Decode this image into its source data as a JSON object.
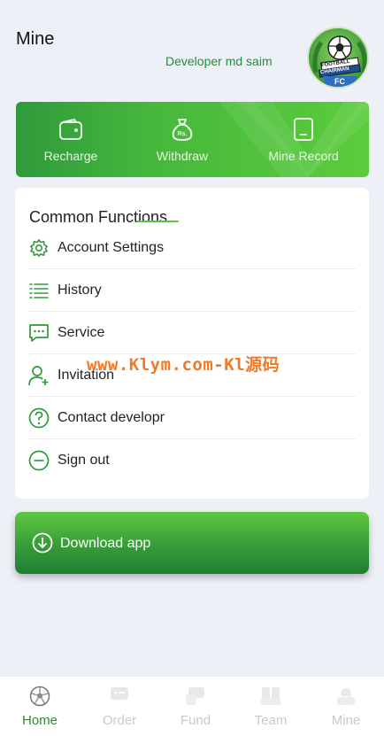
{
  "header": {
    "title": "Mine",
    "developer": "Developer md saim",
    "avatar_text_top": "FOOTBALL",
    "avatar_text_mid": "CHAIRMAN",
    "avatar_text_bottom": "FC"
  },
  "banner": {
    "items": [
      {
        "label": "Recharge",
        "icon": "wallet-icon"
      },
      {
        "label": "Withdraw",
        "icon": "money-bag-icon"
      },
      {
        "label": "Mine Record",
        "icon": "tablet-icon"
      }
    ]
  },
  "functions": {
    "title": "Common Functions",
    "items": [
      {
        "label": "Account Settings",
        "icon": "gear-icon"
      },
      {
        "label": "History",
        "icon": "list-icon"
      },
      {
        "label": "Service",
        "icon": "chat-icon"
      },
      {
        "label": "Invitation",
        "icon": "add-user-icon"
      },
      {
        "label": "Contact developr",
        "icon": "question-icon"
      },
      {
        "label": "Sign out",
        "icon": "minus-circle-icon"
      }
    ]
  },
  "watermark": "www.Klym.com-Kl源码",
  "download": {
    "label": "Download app",
    "icon": "download-icon"
  },
  "tabbar": {
    "items": [
      {
        "label": "Home",
        "icon": "football-icon",
        "active": true
      },
      {
        "label": "Order",
        "icon": "order-icon",
        "active": false
      },
      {
        "label": "Fund",
        "icon": "fund-icon",
        "active": false
      },
      {
        "label": "Team",
        "icon": "team-icon",
        "active": false
      },
      {
        "label": "Mine",
        "icon": "mine-icon",
        "active": false
      }
    ]
  },
  "colors": {
    "accent": "#2a8a36",
    "banner_start": "#2f9a3b",
    "banner_end": "#5ccc3c",
    "watermark": "#f07a26",
    "background": "#eef0f7"
  }
}
